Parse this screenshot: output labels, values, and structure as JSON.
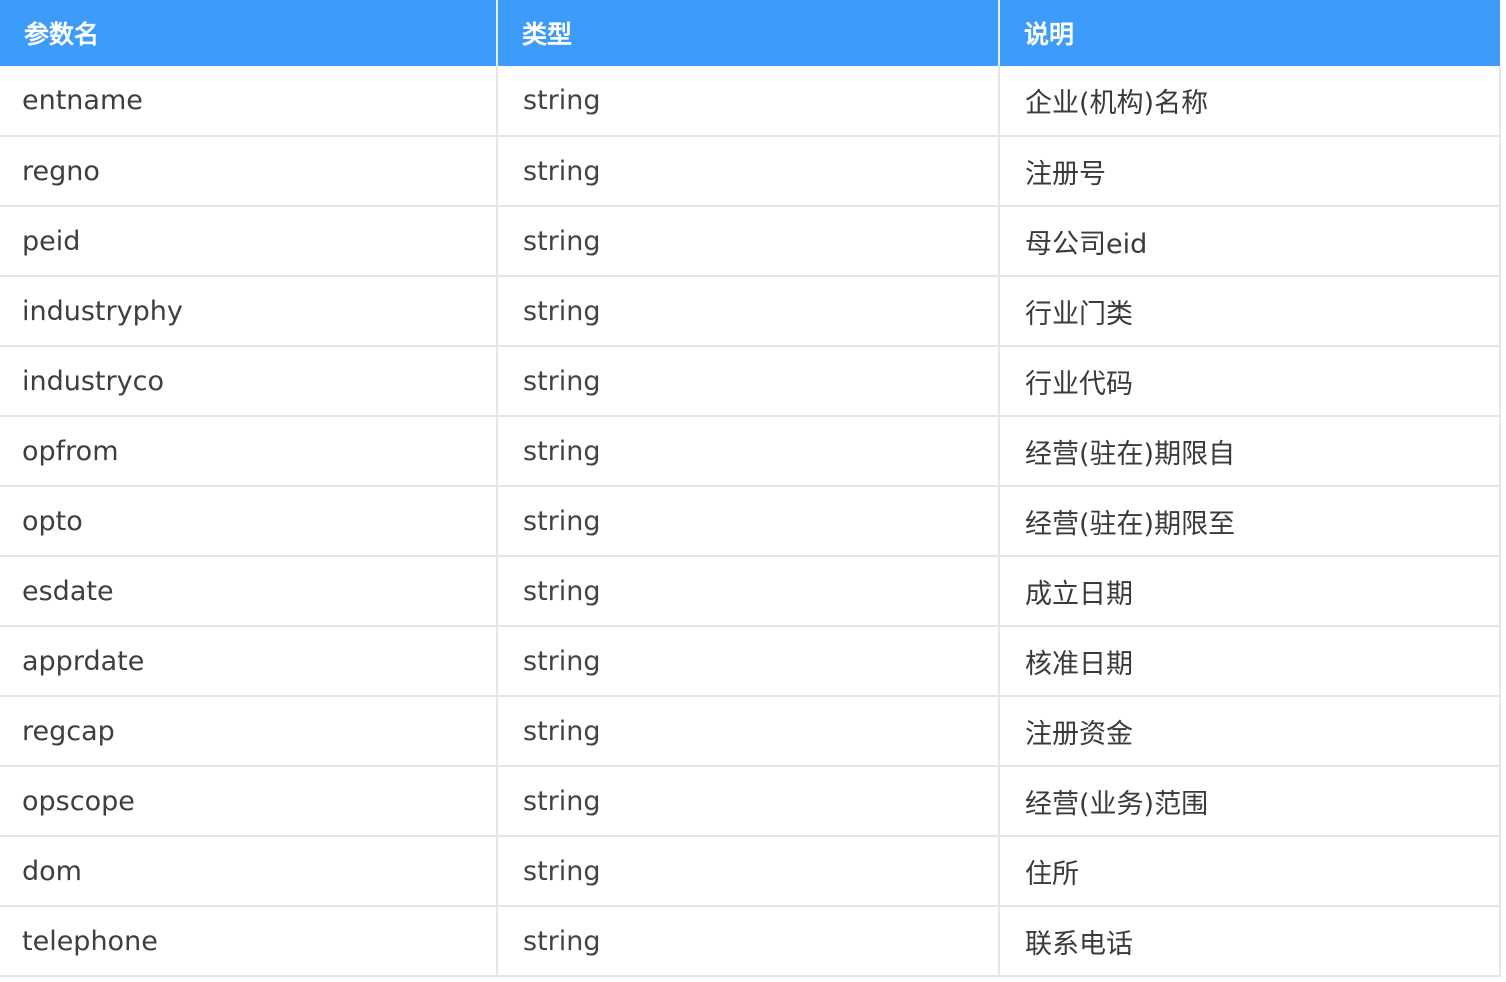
{
  "table": {
    "headers": {
      "name": "参数名",
      "type": "类型",
      "desc": "说明"
    },
    "rows": [
      {
        "name": "entname",
        "type": "string",
        "desc": "企业(机构)名称"
      },
      {
        "name": "regno",
        "type": "string",
        "desc": "注册号"
      },
      {
        "name": "peid",
        "type": "string",
        "desc": "母公司eid"
      },
      {
        "name": "industryphy",
        "type": "string",
        "desc": "行业门类"
      },
      {
        "name": "industryco",
        "type": "string",
        "desc": "行业代码"
      },
      {
        "name": "opfrom",
        "type": "string",
        "desc": "经营(驻在)期限自"
      },
      {
        "name": "opto",
        "type": "string",
        "desc": "经营(驻在)期限至"
      },
      {
        "name": "esdate",
        "type": "string",
        "desc": "成立日期"
      },
      {
        "name": "apprdate",
        "type": "string",
        "desc": "核准日期"
      },
      {
        "name": "regcap",
        "type": "string",
        "desc": "注册资金"
      },
      {
        "name": "opscope",
        "type": "string",
        "desc": "经营(业务)范围"
      },
      {
        "name": "dom",
        "type": "string",
        "desc": "住所"
      },
      {
        "name": "telephone",
        "type": "string",
        "desc": "联系电话"
      }
    ]
  },
  "colors": {
    "header_bg": "#3d9bfa",
    "header_text": "#ffffff",
    "border": "#e6e6e6",
    "body_text": "#3e3e3e"
  }
}
